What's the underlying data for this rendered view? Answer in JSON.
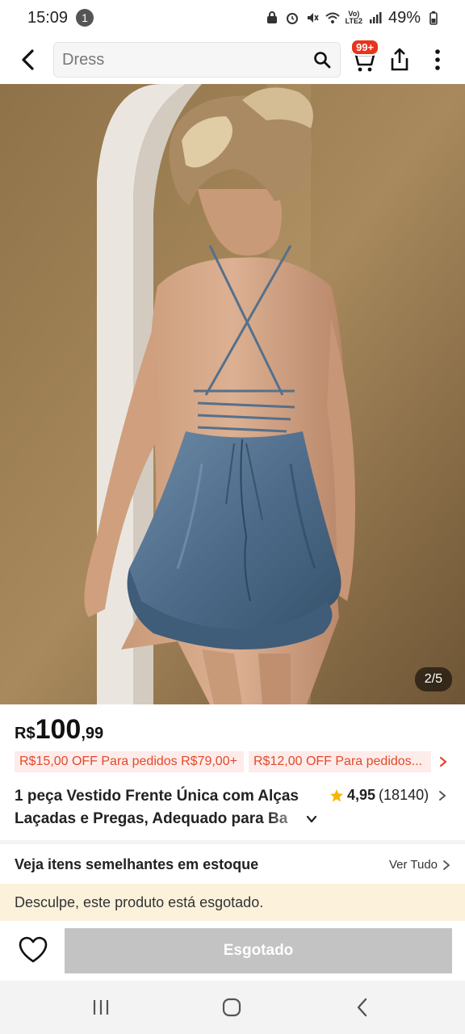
{
  "status_bar": {
    "time": "15:09",
    "notification_count": "1",
    "network_label_top": "Vo)",
    "network_label_bottom": "LTE2",
    "battery": "49%"
  },
  "header": {
    "search_value": "Dress",
    "cart_badge": "99+"
  },
  "gallery": {
    "counter": "2/5"
  },
  "price": {
    "currency": "R$",
    "integer": "100",
    "decimal": ",99"
  },
  "coupons": [
    {
      "label": "R$15,00 OFF Para pedidos R$79,00+"
    },
    {
      "label": "R$12,00 OFF Para pedidos..."
    }
  ],
  "product": {
    "title": "1 peça Vestido Frente Única com Alças Laçadas e Pregas, Adequado para Ba",
    "rating": "4,95",
    "reviews": "(18140)"
  },
  "similar": {
    "title": "Veja itens semelhantes em estoque",
    "link": "Ver Tudo"
  },
  "notice": {
    "text": "Desculpe, este produto está esgotado."
  },
  "actions": {
    "soldout_label": "Esgotado"
  },
  "colors": {
    "accent": "#e8341c",
    "coupon_bg": "#fdecea",
    "coupon_text": "#e24a2b",
    "notice_bg": "#fcf2dc",
    "soldout_bg": "#c3c3c3",
    "star": "#f5b800"
  }
}
